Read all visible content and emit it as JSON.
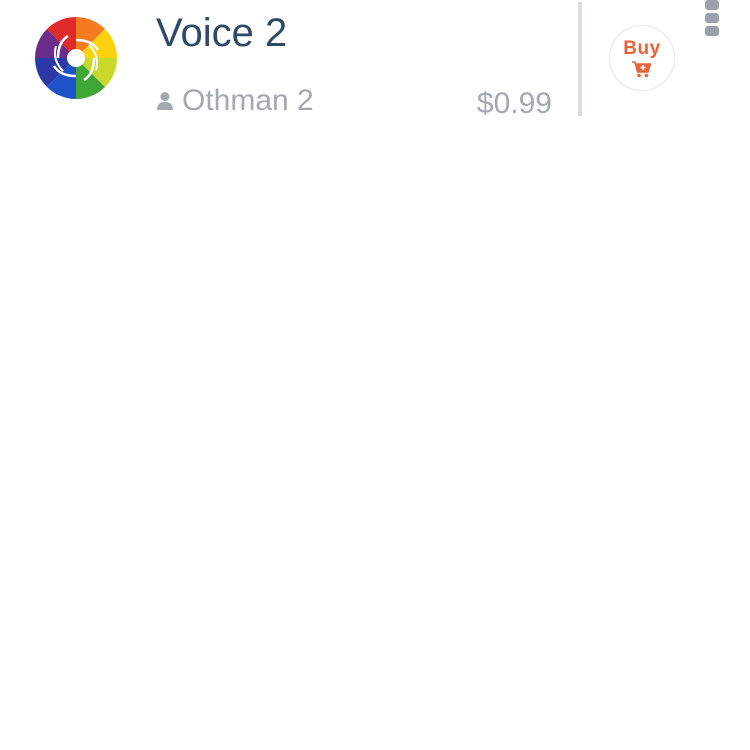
{
  "item": {
    "title": "Voice 2",
    "author": "Othman 2",
    "price": "$0.99",
    "logo_icon": "rainbow-pinwheel-logo"
  },
  "actions": {
    "buy_label": "Buy",
    "buy_icon": "cart-plus-icon",
    "more_icon": "more-vertical-icon"
  },
  "colors": {
    "title": "#2e4a66",
    "secondary_text": "#a3a9b1",
    "buy_accent": "#e8633c",
    "divider": "#d9dde3"
  }
}
